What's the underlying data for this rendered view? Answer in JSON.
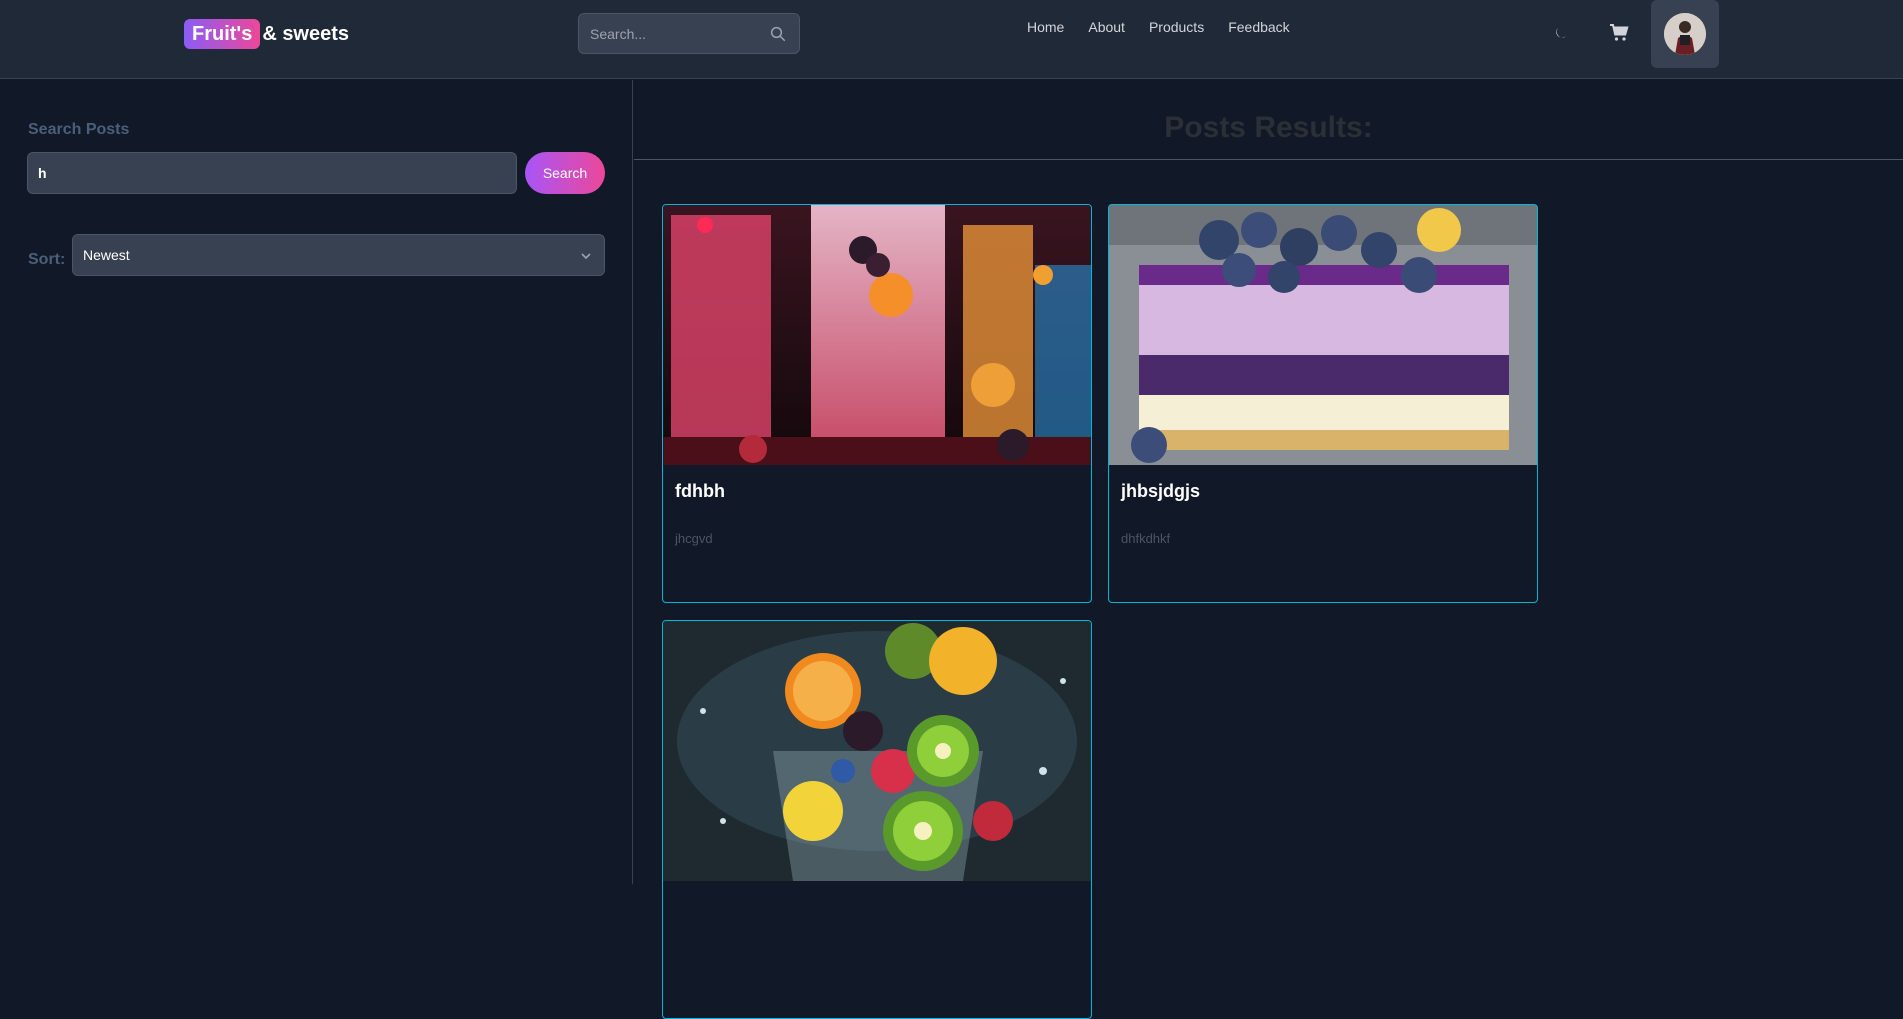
{
  "header": {
    "logo_badge": "Fruit's",
    "logo_rest": "& sweets",
    "search_placeholder": "Search...",
    "nav": [
      "Home",
      "About",
      "Products",
      "Feedback"
    ],
    "icons": [
      "search-icon",
      "moon-icon",
      "cart-icon",
      "avatar"
    ]
  },
  "sidebar": {
    "title": "Search Posts",
    "search_value": "h",
    "search_button": "Search",
    "sort_label": "Sort:",
    "sort_value": "Newest"
  },
  "main": {
    "title": "Posts Results:",
    "posts": [
      {
        "title": "fdhbh",
        "description": "jhcgvd",
        "image": "cocktail-drinks"
      },
      {
        "title": "jhbsjdgjs",
        "description": "dhfkdhkf",
        "image": "blueberry-cheesecake"
      },
      {
        "title": "",
        "description": "",
        "image": "fruit-splash"
      }
    ]
  },
  "colors": {
    "accent_start": "#8b5cf6",
    "accent_end": "#ec4899",
    "card_border": "#06b6d4",
    "bg": "#111827"
  }
}
